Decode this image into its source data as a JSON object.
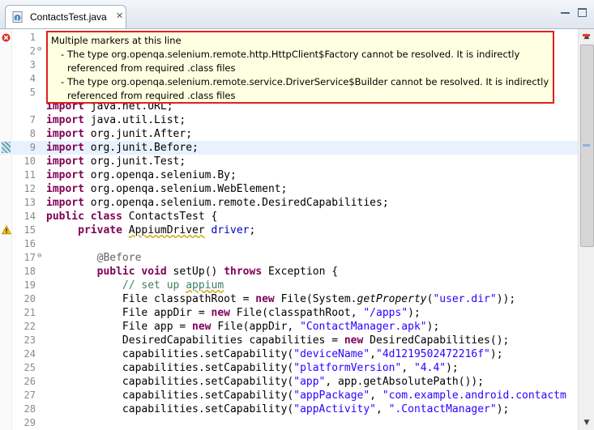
{
  "tab": {
    "title": "ContactsTest.java",
    "close": "✕"
  },
  "window": {
    "minimize": "",
    "maximize": ""
  },
  "popup": {
    "title": "Multiple markers at this line",
    "items": [
      "The type org.openqa.selenium.remote.http.HttpClient$Factory cannot be resolved. It is indirectly referenced from required .class files",
      "The type org.openqa.selenium.remote.service.DriverService$Builder cannot be resolved. It is indirectly referenced from required .class files"
    ]
  },
  "icons": {
    "tab": "java-file-icon",
    "line1": "error-marker-icon",
    "line15": "warning-marker-icon",
    "line9": "bookmark-marker-icon"
  },
  "colors": {
    "keyword": "#7f0055",
    "string": "#2a00ff",
    "comment": "#3f7f5f",
    "field": "#0000c0",
    "annotation": "#646464",
    "popup_border": "#e0201c",
    "popup_bg": "#ffffe1"
  },
  "scrollbar": {
    "up": "▲",
    "down": "▼"
  },
  "lines": [
    {
      "n": "1",
      "tokens": []
    },
    {
      "n": "2",
      "fold": "⊖",
      "tokens": []
    },
    {
      "n": "3",
      "tokens": []
    },
    {
      "n": "4",
      "tokens": []
    },
    {
      "n": "5",
      "tokens": []
    },
    {
      "n": "",
      "tokens": [
        [
          "kw",
          "import"
        ],
        [
          "",
          " java.net.URL;"
        ]
      ]
    },
    {
      "n": "7",
      "tokens": [
        [
          "kw",
          "import"
        ],
        [
          "",
          " java.util.List;"
        ]
      ]
    },
    {
      "n": "8",
      "tokens": [
        [
          "kw",
          "import"
        ],
        [
          "",
          " org.junit.After;"
        ]
      ]
    },
    {
      "n": "9",
      "tokens": [
        [
          "kw",
          "import"
        ],
        [
          "",
          " org.junit.Before;"
        ]
      ]
    },
    {
      "n": "10",
      "tokens": [
        [
          "kw",
          "import"
        ],
        [
          "",
          " org.junit.Test;"
        ]
      ]
    },
    {
      "n": "11",
      "tokens": [
        [
          "kw",
          "import"
        ],
        [
          "",
          " org.openqa.selenium.By;"
        ]
      ]
    },
    {
      "n": "12",
      "tokens": [
        [
          "kw",
          "import"
        ],
        [
          "",
          " org.openqa.selenium.WebElement;"
        ]
      ]
    },
    {
      "n": "13",
      "tokens": [
        [
          "kw",
          "import"
        ],
        [
          "",
          " org.openqa.selenium.remote.DesiredCapabilities;"
        ]
      ]
    },
    {
      "n": "14",
      "tokens": [
        [
          "kw",
          "public"
        ],
        [
          "",
          " "
        ],
        [
          "kw",
          "class"
        ],
        [
          "",
          " ContactsTest {"
        ]
      ]
    },
    {
      "n": "15",
      "tokens": [
        [
          "",
          "     "
        ],
        [
          "kw",
          "private"
        ],
        [
          "",
          " "
        ],
        [
          "wavy",
          "AppiumDriver"
        ],
        [
          "",
          " "
        ],
        [
          "fld",
          "driver"
        ],
        [
          "",
          ";"
        ]
      ]
    },
    {
      "n": "16",
      "tokens": []
    },
    {
      "n": "17",
      "fold": "⊖",
      "tokens": [
        [
          "",
          "        "
        ],
        [
          "ann",
          "@Before"
        ]
      ]
    },
    {
      "n": "18",
      "tokens": [
        [
          "",
          "        "
        ],
        [
          "kw",
          "public"
        ],
        [
          "",
          " "
        ],
        [
          "kw",
          "void"
        ],
        [
          "",
          " setUp() "
        ],
        [
          "kw",
          "throws"
        ],
        [
          "",
          " Exception {"
        ]
      ]
    },
    {
      "n": "19",
      "tokens": [
        [
          "",
          "            "
        ],
        [
          "cm",
          "// set up "
        ],
        [
          "cmw",
          "appium"
        ]
      ]
    },
    {
      "n": "20",
      "tokens": [
        [
          "",
          "            File classpathRoot = "
        ],
        [
          "kw",
          "new"
        ],
        [
          "",
          " File(System."
        ],
        [
          "it",
          "getProperty"
        ],
        [
          "",
          "("
        ],
        [
          "str",
          "\"user.dir\""
        ],
        [
          "",
          "));"
        ]
      ]
    },
    {
      "n": "21",
      "tokens": [
        [
          "",
          "            File appDir = "
        ],
        [
          "kw",
          "new"
        ],
        [
          "",
          " File(classpathRoot, "
        ],
        [
          "str",
          "\"/apps\""
        ],
        [
          "",
          ");"
        ]
      ]
    },
    {
      "n": "22",
      "tokens": [
        [
          "",
          "            File app = "
        ],
        [
          "kw",
          "new"
        ],
        [
          "",
          " File(appDir, "
        ],
        [
          "str",
          "\"ContactManager.apk\""
        ],
        [
          "",
          ");"
        ]
      ]
    },
    {
      "n": "23",
      "tokens": [
        [
          "",
          "            DesiredCapabilities capabilities = "
        ],
        [
          "kw",
          "new"
        ],
        [
          "",
          " DesiredCapabilities();"
        ]
      ]
    },
    {
      "n": "24",
      "tokens": [
        [
          "",
          "            capabilities.setCapability("
        ],
        [
          "str",
          "\"deviceName\""
        ],
        [
          "",
          ","
        ],
        [
          "str",
          "\"4d1219502472216f\""
        ],
        [
          "",
          ");"
        ]
      ]
    },
    {
      "n": "25",
      "tokens": [
        [
          "",
          "            capabilities.setCapability("
        ],
        [
          "str",
          "\"platformVersion\""
        ],
        [
          "",
          ", "
        ],
        [
          "str",
          "\"4.4\""
        ],
        [
          "",
          ");"
        ]
      ]
    },
    {
      "n": "26",
      "tokens": [
        [
          "",
          "            capabilities.setCapability("
        ],
        [
          "str",
          "\"app\""
        ],
        [
          "",
          ", app.getAbsolutePath());"
        ]
      ]
    },
    {
      "n": "27",
      "tokens": [
        [
          "",
          "            capabilities.setCapability("
        ],
        [
          "str",
          "\"appPackage\""
        ],
        [
          "",
          ", "
        ],
        [
          "str",
          "\"com.example.android.contactm"
        ]
      ]
    },
    {
      "n": "28",
      "tokens": [
        [
          "",
          "            capabilities.setCapability("
        ],
        [
          "str",
          "\"appActivity\""
        ],
        [
          "",
          ", "
        ],
        [
          "str",
          "\".ContactManager\""
        ],
        [
          "",
          ");"
        ]
      ]
    },
    {
      "n": "29",
      "tokens": []
    }
  ]
}
